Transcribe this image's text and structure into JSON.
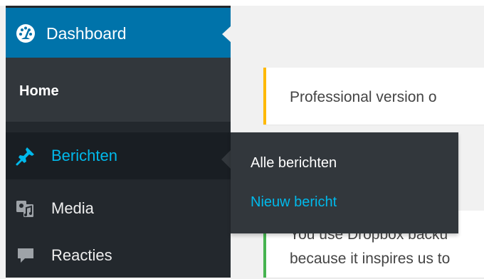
{
  "sidebar": {
    "dashboard": {
      "label": "Dashboard",
      "icon": "dashboard-gauge-icon"
    },
    "home": {
      "label": "Home"
    },
    "items": [
      {
        "label": "Berichten",
        "icon": "pushpin-icon",
        "active": true
      },
      {
        "label": "Media",
        "icon": "media-icon"
      },
      {
        "label": "Reacties",
        "icon": "comment-icon"
      }
    ]
  },
  "flyout": {
    "items": [
      {
        "label": "Alle berichten"
      },
      {
        "label": "Nieuw bericht"
      }
    ]
  },
  "notices": {
    "pro": {
      "text": "Professional version o"
    },
    "dropbox": {
      "line1": "You use Dropbox backu",
      "line2": "because it inspires us to"
    }
  },
  "colors": {
    "sidebar_bg": "#23282d",
    "active_blue": "#0073aa",
    "highlight_text": "#00b9eb",
    "notice_warning": "#ffb900",
    "notice_success": "#46b450"
  }
}
